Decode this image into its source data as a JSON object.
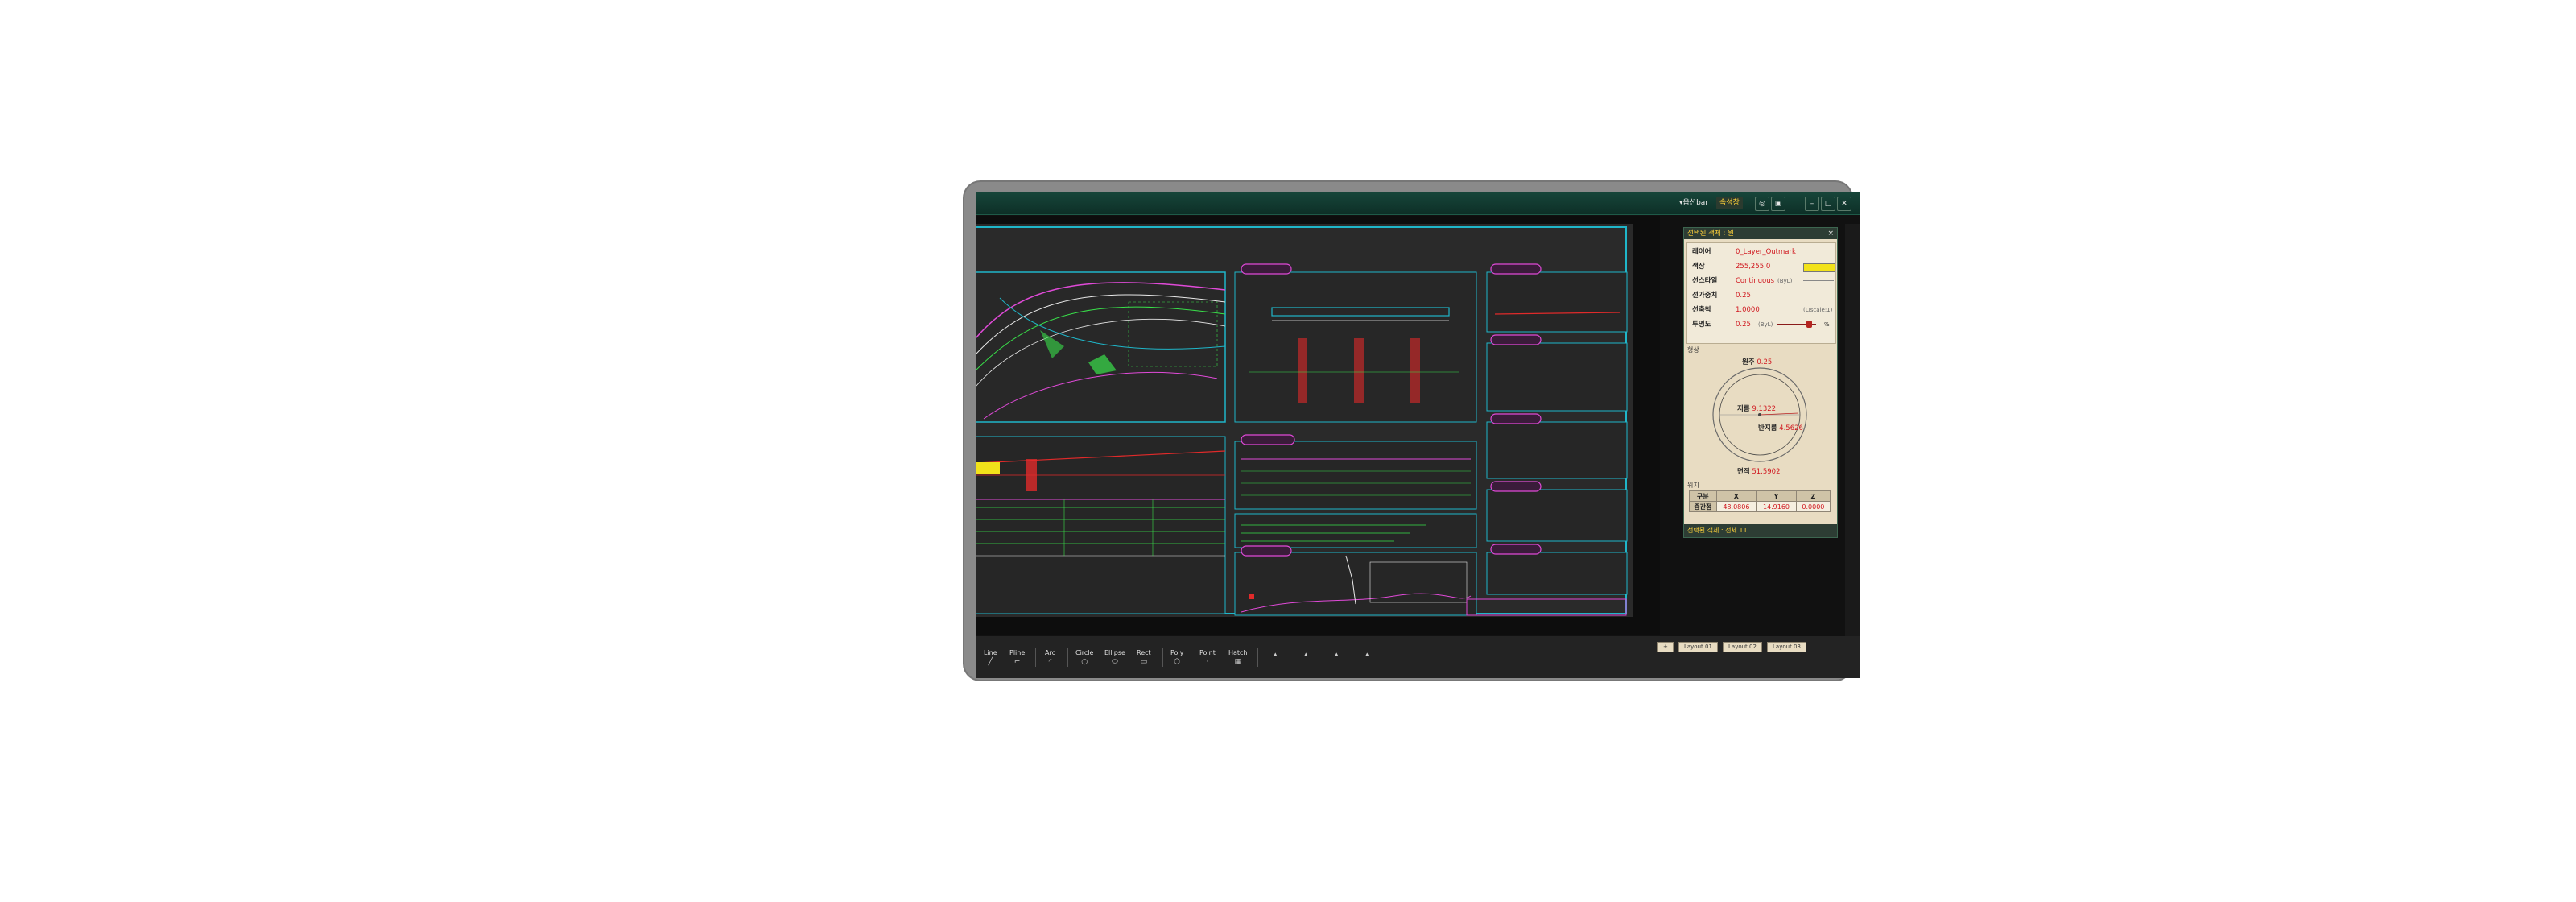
{
  "titlebar": {
    "menu_label": "▾옵션bar",
    "toggle_label": "속성창"
  },
  "properties_panel": {
    "title": "선택된 객체 : 원",
    "close": "×",
    "attributes": [
      {
        "label": "레이어",
        "value": "0_Layer_Outmark"
      },
      {
        "label": "색상",
        "value": "255,255,0"
      },
      {
        "label": "선스타일",
        "value": "Continuous"
      },
      {
        "label": "선가중치",
        "value": "0.25"
      },
      {
        "label": "선축척",
        "value": "1.0000"
      },
      {
        "label": "투명도",
        "value": "0.25"
      }
    ],
    "linetype_suffix": "(ByL)",
    "scale_suffix": "(LTscale:1)",
    "transparency_suffix": "(ByL)",
    "percent_sign": "%",
    "geometry_label": "형상",
    "geometry": {
      "circumference_label": "원주",
      "circumference": "0.25",
      "diameter_label": "지름",
      "diameter": "9.1322",
      "radius_label": "반지름",
      "radius": "4.5626",
      "area_label": "면적",
      "area": "51.5902"
    },
    "position_label": "위치",
    "coords": {
      "headers": [
        "구분",
        "X",
        "Y",
        "Z"
      ],
      "row_label": "중간점",
      "values": [
        "48.0806",
        "14.9160",
        "0.0000"
      ]
    },
    "footer": "선택된 객체 : 전체 11"
  },
  "layout_tabs": [
    "+",
    "Layout 01",
    "Layout 02",
    "Layout 03"
  ],
  "tools": [
    {
      "label": "Line",
      "icon": "╱"
    },
    {
      "label": "Pline",
      "icon": "⌐"
    },
    {
      "label": "Arc",
      "icon": "◜"
    },
    {
      "label": "Circle",
      "icon": "○"
    },
    {
      "label": "Ellipse",
      "icon": "⬭"
    },
    {
      "label": "Rect",
      "icon": "▭"
    },
    {
      "label": "Poly",
      "icon": "⬡"
    },
    {
      "label": "Point",
      "icon": "·"
    },
    {
      "label": "Hatch",
      "icon": "▦"
    }
  ],
  "colors": {
    "accent": "#ffd23a",
    "drawing_cyan": "#1fb6c9",
    "drawing_green": "#39e04a",
    "drawing_magenta": "#e04ad8",
    "drawing_red": "#e02a2a"
  }
}
